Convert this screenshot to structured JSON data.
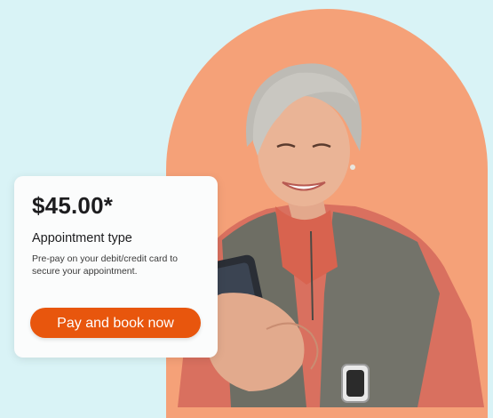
{
  "card": {
    "price": "$45.00*",
    "appointment_type": "Appointment type",
    "description": "Pre-pay on your debit/credit card to secure your appointment.",
    "button_label": "Pay and book now"
  },
  "colors": {
    "background": "#d9f3f6",
    "arch": "#f5a178",
    "button": "#e8560d",
    "card": "#fbfcfc"
  }
}
